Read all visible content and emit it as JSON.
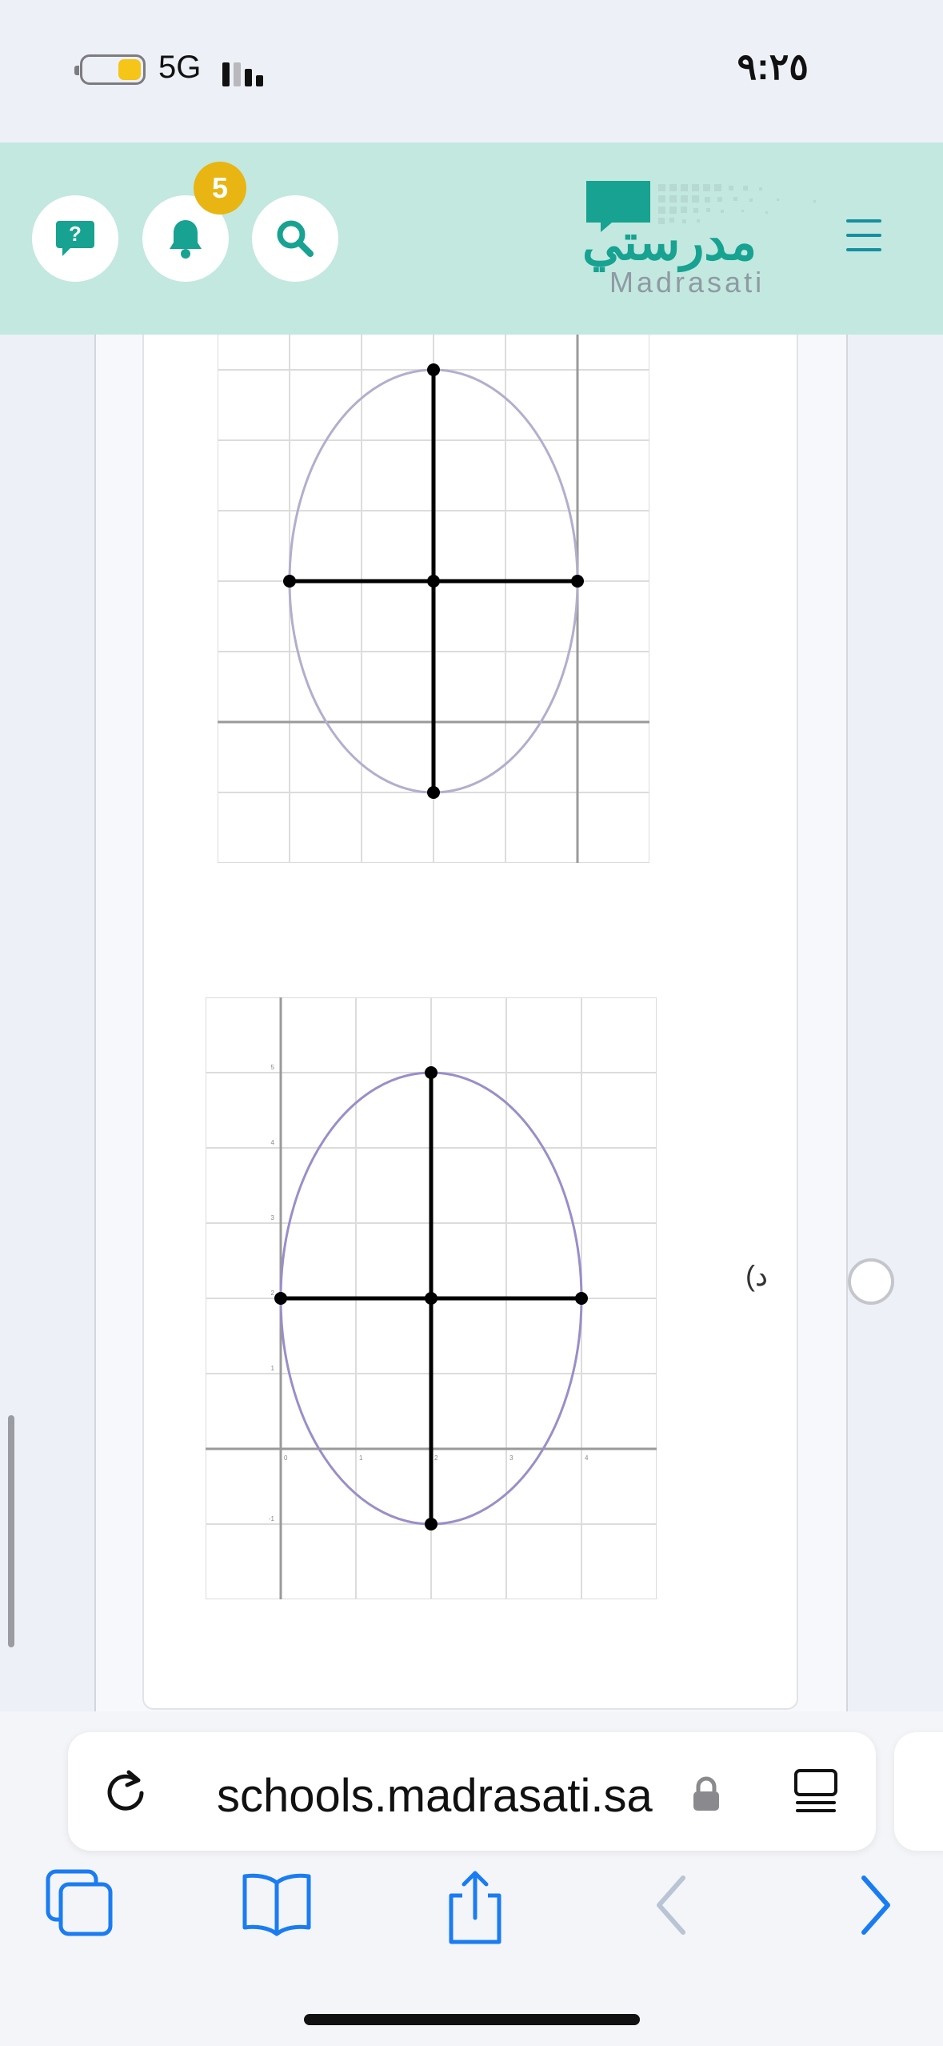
{
  "status_bar": {
    "time": "٩:٢٥",
    "network": "5G"
  },
  "header": {
    "help_icon": "question-chat-icon",
    "notifications_icon": "bell-icon",
    "notifications_count": "5",
    "search_icon": "search-icon",
    "logo_arabic": "مدرستي",
    "logo_english": "Madrasati",
    "menu_icon": "hamburger-menu-icon",
    "colors": {
      "header_bg": "#c2e8e0",
      "accent": "#17a291",
      "badge": "#e8b512"
    }
  },
  "question": {
    "option_label": "د)",
    "option_selected": false
  },
  "chart_data": [
    {
      "type": "scatter",
      "description_key": "option-c-graph",
      "curve": "ellipse",
      "center": [
        -2,
        2
      ],
      "semi_axis_x": 2,
      "semi_axis_y": 3,
      "points": [
        [
          -2,
          5
        ],
        [
          -2,
          -1
        ],
        [
          -4,
          2
        ],
        [
          0,
          2
        ],
        [
          -2,
          2
        ]
      ],
      "xlim": [
        -5,
        1
      ],
      "ylim": [
        -2,
        5.5
      ],
      "grid": true
    },
    {
      "type": "scatter",
      "description_key": "option-d-graph",
      "curve": "ellipse",
      "center": [
        2,
        2
      ],
      "semi_axis_x": 2,
      "semi_axis_y": 3,
      "points": [
        [
          2,
          5
        ],
        [
          2,
          -1
        ],
        [
          0,
          2
        ],
        [
          4,
          2
        ],
        [
          2,
          2
        ]
      ],
      "xlim": [
        -1,
        5
      ],
      "ylim": [
        -2,
        6
      ],
      "tick_labels_x": [
        "0",
        "1",
        "2",
        "3",
        "4"
      ],
      "tick_labels_y": [
        "-1",
        "1",
        "2",
        "3",
        "4",
        "5"
      ],
      "grid": true
    }
  ],
  "browser": {
    "url": "schools.madrasati.sa",
    "reload_icon": "reload-icon",
    "lock_icon": "lock-icon",
    "reader_icon": "reader-mode-icon",
    "toolbar": [
      "tabs-icon",
      "bookmarks-icon",
      "share-icon",
      "back-icon",
      "forward-icon"
    ]
  },
  "accessibility_icon": "accessibility-icon"
}
